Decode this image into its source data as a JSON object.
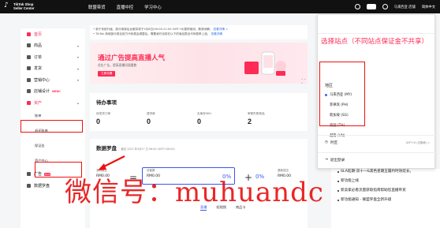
{
  "topbar": {
    "brand_line1": "TikTok Shop",
    "brand_line2": "Seller Center",
    "nav": [
      "联盟带货",
      "直播中控",
      "学习中心"
    ],
    "store_label": "马来西亚 店铺",
    "language": "简体中文"
  },
  "notice": {
    "line1": "• 新于系统升级，部分商家后台服务将于5月8日(00:00-21:00 GMT+8)暂停使用，敬请谅解。",
    "line1_link": "查看详情 >",
    "line2": "• TikTok 商城部分类目官方代码费会调整后，需要我们也将在以下的商品类目代码费率上涨。",
    "line2_link": "查看详情"
  },
  "banner": {
    "title": "通过广告提高直播人气",
    "subtitle": "优化广告，提高直播间观看数",
    "button": "立即设置"
  },
  "todo": {
    "title": "待办事项",
    "items": [
      {
        "label": "待发货订单",
        "value": "0"
      },
      {
        "label": "退货单",
        "value": "0"
      },
      {
        "label": "无库存SKU",
        "value": "0"
      },
      {
        "label": "审核失败商品",
        "value": "2"
      }
    ]
  },
  "data_panel": {
    "title": "数据罗盘",
    "date": "截至 2022 年5月27 日 06:00 (GMT+08:00)",
    "gmv_label": "支付成交",
    "gmv_value": "RM0.00",
    "visitor_label": "访客数",
    "visitor_value": "RM0.00",
    "conv_label": "转化率",
    "conv_value": "0%",
    "aov_label": "客单价",
    "aov_value": "0%",
    "refund_label": "退款成交",
    "refund_value": "RM0.00",
    "eq_sign": "=",
    "plus_sign": "+",
    "tabs": [
      "直播",
      "短视频",
      "商品卡"
    ]
  },
  "sidebar": {
    "items": [
      {
        "label": "首页"
      },
      {
        "label": "商品"
      },
      {
        "label": "订单"
      },
      {
        "label": "发货"
      },
      {
        "label": "营销中心"
      },
      {
        "label": "店铺设计",
        "badge": "NEW!"
      },
      {
        "label": "资产"
      }
    ],
    "asset_subitems": [
      "账单",
      "退还账单",
      "保证金",
      "资产中心"
    ],
    "bottom_items": [
      {
        "label": "广告",
        "badge": "HOT"
      },
      {
        "label": "数据罗盘"
      }
    ]
  },
  "dropdown": {
    "annotation": "选择站点（不同站点保证金不共享）",
    "region_label": "地区",
    "regions": [
      {
        "label": "马来西亚 (MY)",
        "selected": true
      },
      {
        "label": "菲律宾 (PH)",
        "selected": false
      },
      {
        "label": "新加坡 (SG)",
        "selected": false
      },
      {
        "label": "泰国 (TH)",
        "selected": false
      },
      {
        "label": "越南 (VN)",
        "selected": false
      }
    ],
    "timezone_label": "时区",
    "timezone_value": "GMT+8 (吉隆坡) >",
    "logout_label": "退出登录"
  },
  "announcements": [
    "SLA延期-双十一&黑色星期五履约时效延长。",
    "新功能上线",
    "新卖家必看流量获取指南帮助您直播带货",
    "新功能通知 - 联盟罗盘全新升级"
  ],
  "watermark": "微信号：muhuandc",
  "colors": {
    "brand": "#fe2c55",
    "accent": "#3a57e8",
    "annotation": "#e11111"
  }
}
